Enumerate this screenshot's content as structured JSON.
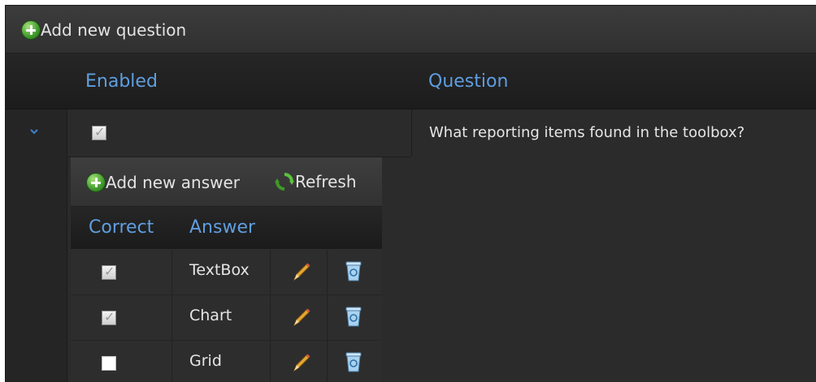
{
  "toolbar": {
    "add_question_label": "Add new question"
  },
  "grid": {
    "headers": {
      "enabled": "Enabled",
      "question": "Question"
    },
    "rows": [
      {
        "enabled": true,
        "question": "What reporting items found in the toolbox?"
      }
    ]
  },
  "detail": {
    "toolbar": {
      "add_answer_label": "Add new answer",
      "refresh_label": "Refresh"
    },
    "headers": {
      "correct": "Correct",
      "answer": "Answer"
    },
    "answers": [
      {
        "correct": true,
        "text": "TextBox"
      },
      {
        "correct": true,
        "text": "Chart"
      },
      {
        "correct": false,
        "text": "Grid"
      }
    ]
  },
  "colors": {
    "accent": "#5f9ee0",
    "background": "#2b2b2b",
    "plus_green": "#3f9a2c"
  },
  "icons": [
    "plus-icon",
    "chevron-down-icon",
    "refresh-icon",
    "pencil-icon",
    "trash-icon"
  ]
}
